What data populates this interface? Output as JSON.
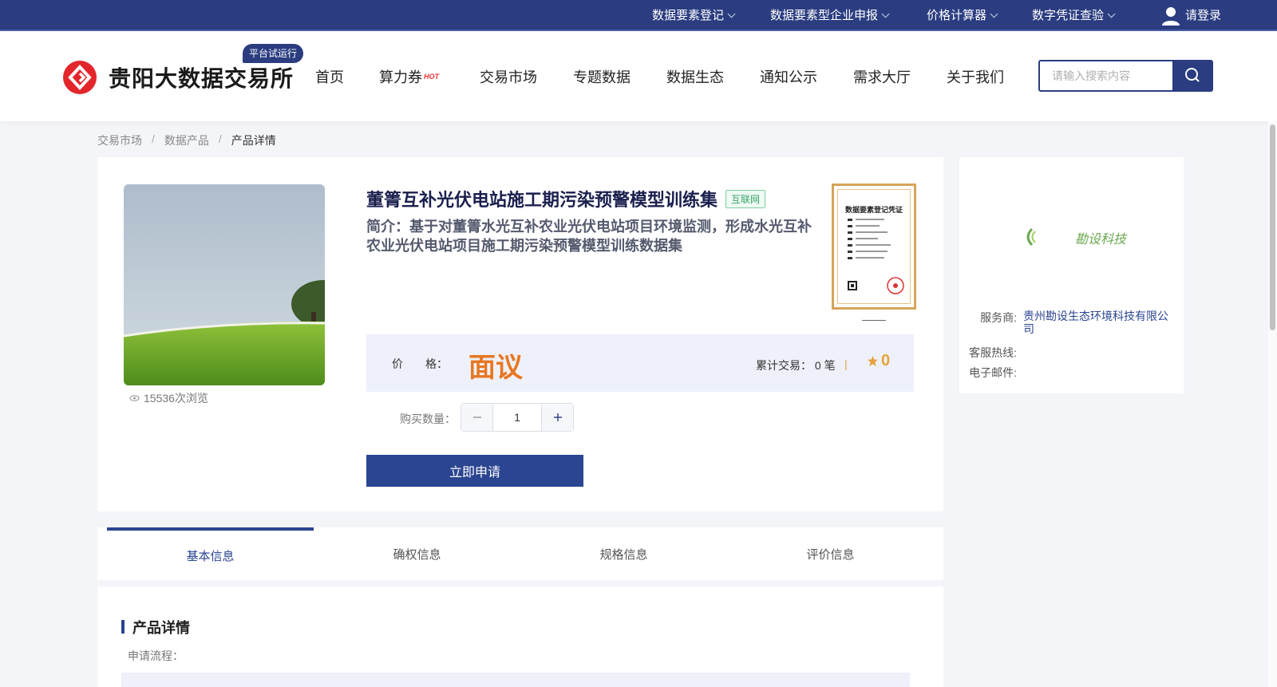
{
  "topbar": {
    "items": [
      {
        "label": "数据要素登记"
      },
      {
        "label": "数据要素型企业申报"
      },
      {
        "label": "价格计算器"
      },
      {
        "label": "数字凭证查验"
      }
    ],
    "login": "请登录"
  },
  "header": {
    "logo_text": "贵阳大数据交易所",
    "beta_badge": "平台试运行",
    "nav": [
      "首页",
      "算力券",
      "交易市场",
      "专题数据",
      "数据生态",
      "通知公示",
      "需求大厅",
      "关于我们"
    ],
    "hot_label": "HOT",
    "search_placeholder": "请输入搜索内容"
  },
  "breadcrumb": [
    "交易市场",
    "数据产品",
    "产品详情"
  ],
  "product": {
    "title": "董箐互补光伏电站施工期污染预警模型训练集",
    "tag": "互联网",
    "summary": "简介：基于对董箐水光互补农业光伏电站项目环境监测，形成水光互补农业光伏电站项目施工期污染预警模型训练数据集",
    "views": "15536次浏览",
    "price_label": "价　　格：",
    "price_value": "面议",
    "trade_label": "累计交易： 0 笔",
    "pipe": "|",
    "rating": "0",
    "qty_label": "购买数量：",
    "qty_value": "1",
    "apply_button": "立即申请",
    "cert_title": "数据要素登记凭证"
  },
  "provider": {
    "logo_text": "勘设科技",
    "rows": [
      {
        "key": "服务商:",
        "value": "贵州勘设生态环境科技有限公司"
      },
      {
        "key": "客服热线:",
        "value": ""
      },
      {
        "key": "电子邮件:",
        "value": ""
      }
    ]
  },
  "tabs": [
    {
      "label": "基本信息",
      "active": true
    },
    {
      "label": "确权信息",
      "active": false
    },
    {
      "label": "规格信息",
      "active": false
    },
    {
      "label": "评价信息",
      "active": false
    }
  ],
  "detail": {
    "title": "产品详情",
    "sub": "申请流程："
  },
  "colors": {
    "brand": "#2b3d80",
    "accent": "#e87722",
    "rating": "#e6a23c"
  }
}
